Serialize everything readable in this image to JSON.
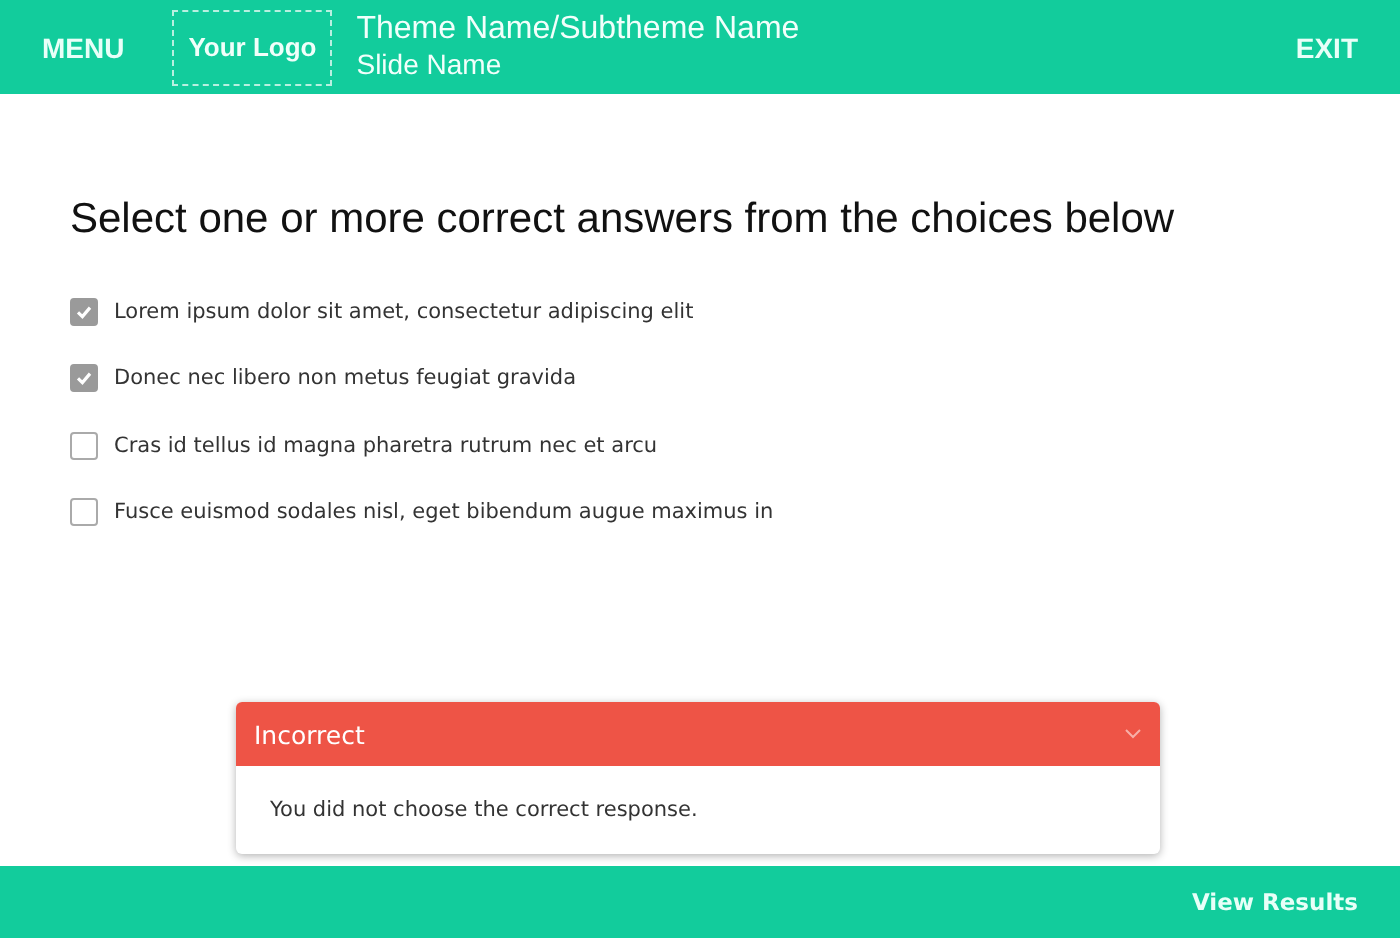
{
  "header": {
    "menu": "MENU",
    "logo": "Your Logo",
    "theme": "Theme Name/Subtheme Name",
    "slide": "Slide Name",
    "exit": "EXIT"
  },
  "question": "Select one or more correct answers from the choices below",
  "choices": [
    {
      "label": "Lorem ipsum dolor sit amet, consectetur adipiscing elit",
      "checked": true
    },
    {
      "label": "Donec nec libero non metus feugiat gravida",
      "checked": true
    },
    {
      "label": "Cras id tellus id magna pharetra rutrum nec et arcu",
      "checked": false
    },
    {
      "label": "Fusce euismod sodales nisl, eget bibendum augue maximus in",
      "checked": false
    }
  ],
  "feedback": {
    "title": "Incorrect",
    "message": "You did not choose the correct response.",
    "expanded": true
  },
  "footer": {
    "button": "View Results"
  }
}
